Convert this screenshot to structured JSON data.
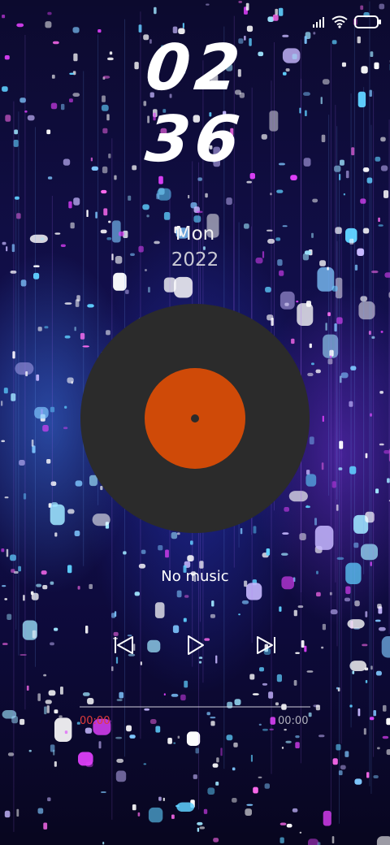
{
  "status_bar": {
    "icons": [
      "cellular-signal-icon",
      "wifi-icon",
      "battery-icon"
    ]
  },
  "clock": {
    "hours": "02",
    "minutes": "36"
  },
  "date": {
    "day": "Mon",
    "year": "2022"
  },
  "player": {
    "track_title": "No music",
    "controls": [
      "previous-icon",
      "play-icon",
      "next-icon"
    ],
    "time_current": "00:00",
    "time_total": "00:00",
    "progress": 0
  },
  "colors": {
    "vinyl_disc": "#2b2b2b",
    "vinyl_label": "#cf4a08",
    "time_current": "#e23b3b"
  }
}
